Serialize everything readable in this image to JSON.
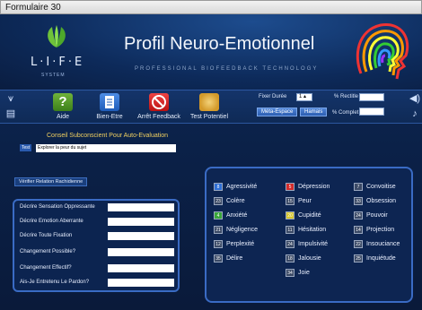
{
  "window": {
    "title": "Formulaire 30"
  },
  "header": {
    "logo_text": "L·I·F·E",
    "logo_sub": "SYSTEM",
    "title": "Profil Neuro-Emotionnel",
    "subtitle": "PROFESSIONAL BIOFEEDBACK TECHNOLOGY"
  },
  "toolbar": {
    "aide": "Aide",
    "bien_etre": "Bien-Etre",
    "arret": "Arrêt Feedback",
    "test": "Test Potentiel",
    "fixer_duree": "Fixer Durée",
    "duree_value": "1",
    "rectitle": "% Rectitle",
    "meta_espace": "Méta-Espace",
    "hamais": "Hamais",
    "complet": "% Complet"
  },
  "conseil": {
    "title": "Conseil Subconscient Pour Auto-Evaluation",
    "test_label": "Test",
    "test_value": "Explorer la peur du sujet"
  },
  "verify_button": "Vérifier Relation Rachidienne",
  "questions": [
    "Décrire Sensation Oppressante",
    "Décrire Emotion Aberrante",
    "Décrire Toute Fixation",
    "Changement Possible?",
    "Changement Effectif?",
    "Ais-Je Entretenu Le Pardon?"
  ],
  "emotions": {
    "col1": [
      {
        "num": "8",
        "label": "Agressivité",
        "color": "#2f6fd6"
      },
      {
        "num": "23",
        "label": "Colère",
        "color": "#3b4a66"
      },
      {
        "num": "4",
        "label": "Anxiété",
        "color": "#3aa63a"
      },
      {
        "num": "21",
        "label": "Négligence",
        "color": "#3b4a66"
      },
      {
        "num": "12",
        "label": "Perplexité",
        "color": "#3b4a66"
      },
      {
        "num": "35",
        "label": "Délire",
        "color": "#3b4a66"
      }
    ],
    "col2": [
      {
        "num": "5",
        "label": "Dépression",
        "color": "#d22a2a"
      },
      {
        "num": "15",
        "label": "Peur",
        "color": "#3b4a66"
      },
      {
        "num": "20",
        "label": "Cupidité",
        "color": "#d6c62a"
      },
      {
        "num": "11",
        "label": "Hésitation",
        "color": "#3b4a66"
      },
      {
        "num": "24",
        "label": "Impulsivité",
        "color": "#3b4a66"
      },
      {
        "num": "18",
        "label": "Jalousie",
        "color": "#3b4a66"
      },
      {
        "num": "34",
        "label": "Joie",
        "color": "#3b4a66"
      }
    ],
    "col3": [
      {
        "num": "7",
        "label": "Convoitise",
        "color": "#3b4a66"
      },
      {
        "num": "33",
        "label": "Obsession",
        "color": "#3b4a66"
      },
      {
        "num": "24",
        "label": "Pouvoir",
        "color": "#3b4a66"
      },
      {
        "num": "14",
        "label": "Projection",
        "color": "#3b4a66"
      },
      {
        "num": "22",
        "label": "Insouciance",
        "color": "#3b4a66"
      },
      {
        "num": "25",
        "label": "Inquiétude",
        "color": "#3b4a66"
      }
    ]
  }
}
